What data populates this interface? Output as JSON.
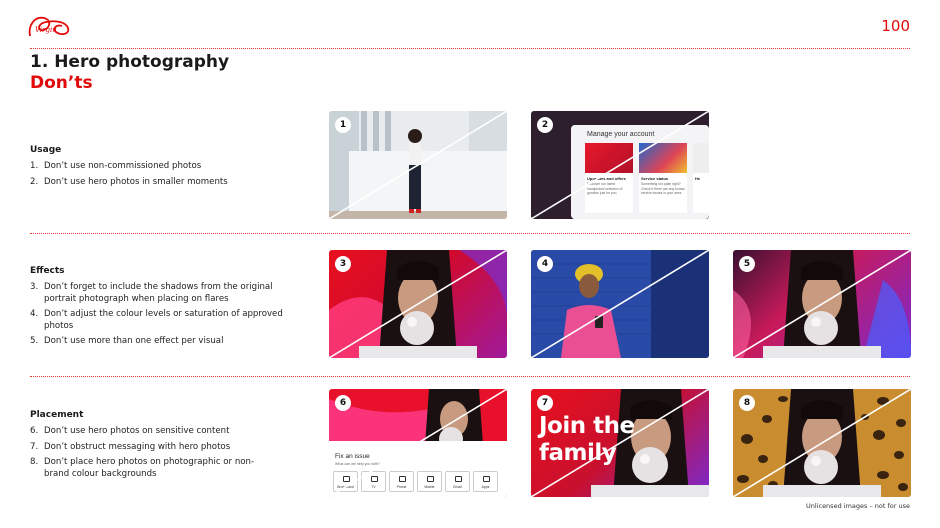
{
  "page_number": "100",
  "title": {
    "line1": "1. Hero photography",
    "line2": "Don’ts"
  },
  "sections": {
    "usage": {
      "heading": "Usage",
      "items": [
        {
          "n": "1.",
          "text": "Don’t use non-commissioned photos"
        },
        {
          "n": "2.",
          "text": "Don’t use hero photos in smaller moments"
        }
      ]
    },
    "effects": {
      "heading": "Effects",
      "items": [
        {
          "n": "3.",
          "text": "Don’t forget to include the shadows from the original portrait photograph when placing on flares"
        },
        {
          "n": "4.",
          "text": "Don’t adjust the colour levels or saturation of approved photos"
        },
        {
          "n": "5.",
          "text": "Don’t use more than one effect per visual"
        }
      ]
    },
    "placement": {
      "heading": "Placement",
      "items": [
        {
          "n": "6.",
          "text": "Don’t use hero photos on sensitive content"
        },
        {
          "n": "7.",
          "text": "Don’t obstruct messaging with hero photos"
        },
        {
          "n": "8.",
          "text": "Don’t place hero photos on photographic or non-brand colour backgrounds"
        }
      ]
    }
  },
  "tiles": {
    "t1": {
      "badge": "1"
    },
    "t2": {
      "badge": "2",
      "card_title": "Manage your account",
      "cards": [
        {
          "heading": "Upgrades and offers",
          "text": "Discover our latest handpicked selection of goodies just for you."
        },
        {
          "heading": "Service status",
          "text": "Something not quite right? Check if there are any known service issues in your area."
        },
        {
          "heading": "He",
          "text": ""
        }
      ]
    },
    "t3": {
      "badge": "3"
    },
    "t4": {
      "badge": "4"
    },
    "t5": {
      "badge": "5"
    },
    "t6": {
      "badge": "6",
      "heading": "Fix an issue",
      "sub": "What can we help you with?",
      "buttons": [
        "Broadband",
        "TV",
        "Phone",
        "Mobile",
        "Email",
        "Apps"
      ]
    },
    "t7": {
      "badge": "7",
      "headline": "Join the family"
    },
    "t8": {
      "badge": "8"
    }
  },
  "footnote": "Unlicensed images – not for use",
  "colors": {
    "brand_red": "#e10a0a",
    "divider": "#e33a3a"
  }
}
